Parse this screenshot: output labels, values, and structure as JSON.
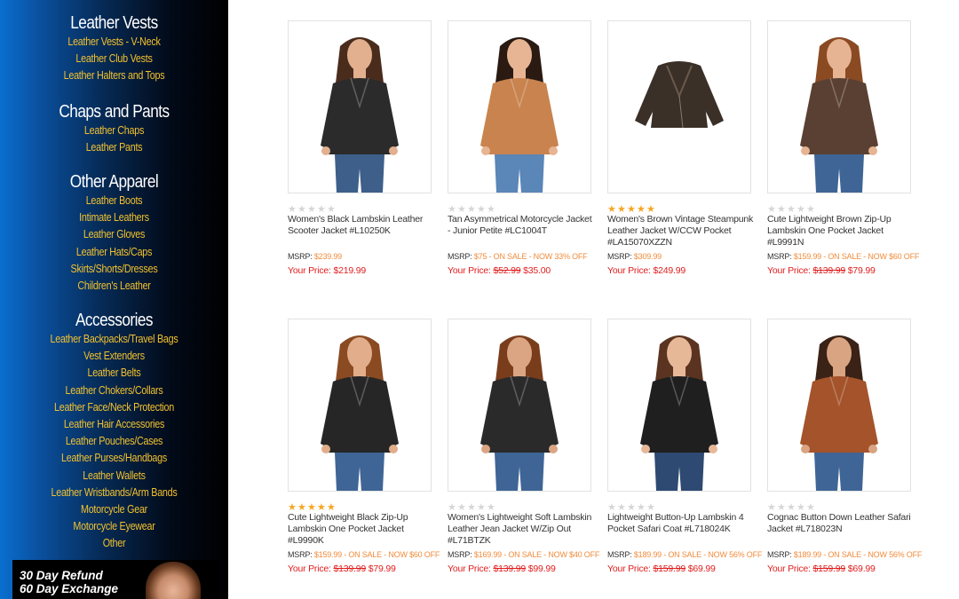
{
  "sidebar": {
    "groups": [
      {
        "heading": "Leather Vests",
        "links": [
          "Leather Vests - V-Neck",
          "Leather Club Vests",
          "Leather Halters and Tops"
        ]
      },
      {
        "heading": "Chaps and Pants",
        "links": [
          "Leather Chaps",
          "Leather Pants"
        ]
      },
      {
        "heading": "Other Apparel",
        "links": [
          "Leather Boots",
          "Intimate Leathers",
          "Leather Gloves",
          "Leather Hats/Caps",
          "Skirts/Shorts/Dresses",
          "Children's Leather"
        ]
      },
      {
        "heading": "Accessories",
        "links": [
          "Leather Backpacks/Travel Bags",
          "Vest Extenders",
          "Leather Belts",
          "Leather Chokers/Collars",
          "Leather Face/Neck Protection",
          "Leather Hair Accessories",
          "Leather Pouches/Cases",
          "Leather Purses/Handbags",
          "Leather Wallets",
          "Leather Wristbands/Arm Bands",
          "Motorcycle Gear",
          "Motorcycle Eyewear",
          "Other"
        ]
      }
    ],
    "promo": {
      "line1": "30 Day Refund",
      "line2": "60 Day Exchange"
    }
  },
  "colors": {
    "link": "#f2c12e",
    "price": "#e01e1e",
    "msrp_value": "#f08c3c",
    "star_on": "#f5a623",
    "star_off": "#d6d6d6"
  },
  "products": [
    {
      "name": "Women's Black Lambskin Leather Scooter Jacket #L10250K",
      "stars": 0,
      "msrp_label": "MSRP:",
      "msrp": "$239.99",
      "price_label": "Your Price:",
      "old_price": "",
      "price": "$219.99",
      "jacket": "#2b2b2b",
      "hair": "#4a2c1c",
      "skin": "#e2b08f",
      "jeans": "#3d5f8a"
    },
    {
      "name": "Tan Asymmetrical Motorcycle Jacket - Junior Petite #LC1004T",
      "stars": 0,
      "msrp_label": "MSRP:",
      "msrp": "$75 - ON SALE - NOW 33% OFF",
      "price_label": "Your Price:",
      "old_price": "$52.99",
      "price": "$35.00",
      "jacket": "#c9834e",
      "hair": "#2a1a12",
      "skin": "#e7b593",
      "jeans": "#5a86b8"
    },
    {
      "name": "Women's Brown Vintage Steampunk Leather Jacket W/CCW Pocket #LA15070XZZN",
      "stars": 5,
      "msrp_label": "MSRP:",
      "msrp": "$309.99",
      "price_label": "Your Price:",
      "old_price": "",
      "price": "$249.99",
      "jacket": "#3a3028",
      "hair": "",
      "skin": "",
      "jeans": ""
    },
    {
      "name": "Cute Lightweight Brown Zip-Up Lambskin One Pocket Jacket #L9991N",
      "stars": 0,
      "msrp_label": "MSRP:",
      "msrp": "$159.99 - ON SALE - NOW $60 OFF",
      "price_label": "Your Price:",
      "old_price": "$139.99",
      "price": "$79.99",
      "jacket": "#5a4032",
      "hair": "#8a4a22",
      "skin": "#e6b492",
      "jeans": "#3f6596"
    },
    {
      "name": "Cute Lightweight Black Zip-Up Lambskin One Pocket Jacket #L9990K",
      "stars": 5,
      "msrp_label": "MSRP:",
      "msrp": "$159.99 - ON SALE - NOW $60 OFF",
      "price_label": "Your Price:",
      "old_price": "$139.99",
      "price": "$79.99",
      "jacket": "#262626",
      "hair": "#8a4a22",
      "skin": "#e2ad8a",
      "jeans": "#3f6596"
    },
    {
      "name": "Women's Lightweight Soft Lambskin Leather Jean Jacket W/Zip Out #L71BTZK",
      "stars": 0,
      "msrp_label": "MSRP:",
      "msrp": "$169.99 - ON SALE - NOW $40 OFF",
      "price_label": "Your Price:",
      "old_price": "$139.99",
      "price": "$99.99",
      "jacket": "#2a2a2a",
      "hair": "#7a3d1c",
      "skin": "#dba583",
      "jeans": "#3f6596"
    },
    {
      "name": "Lightweight Button-Up Lambskin 4 Pocket Safari Coat #L718024K",
      "stars": 0,
      "msrp_label": "MSRP:",
      "msrp": "$189.99 - ON SALE - NOW 56% OFF",
      "price_label": "Your Price:",
      "old_price": "$159.99",
      "price": "$69.99",
      "jacket": "#1f1f1f",
      "hair": "#5a3420",
      "skin": "#e7b898",
      "jeans": "#2e4a72"
    },
    {
      "name": "Cognac Button Down Leather Safari Jacket #L718023N",
      "stars": 0,
      "msrp_label": "MSRP:",
      "msrp": "$189.99 - ON SALE - NOW 56% OFF",
      "price_label": "Your Price:",
      "old_price": "$159.99",
      "price": "$69.99",
      "jacket": "#a4532a",
      "hair": "#3a2216",
      "skin": "#d9a482",
      "jeans": "#3f6596"
    }
  ]
}
